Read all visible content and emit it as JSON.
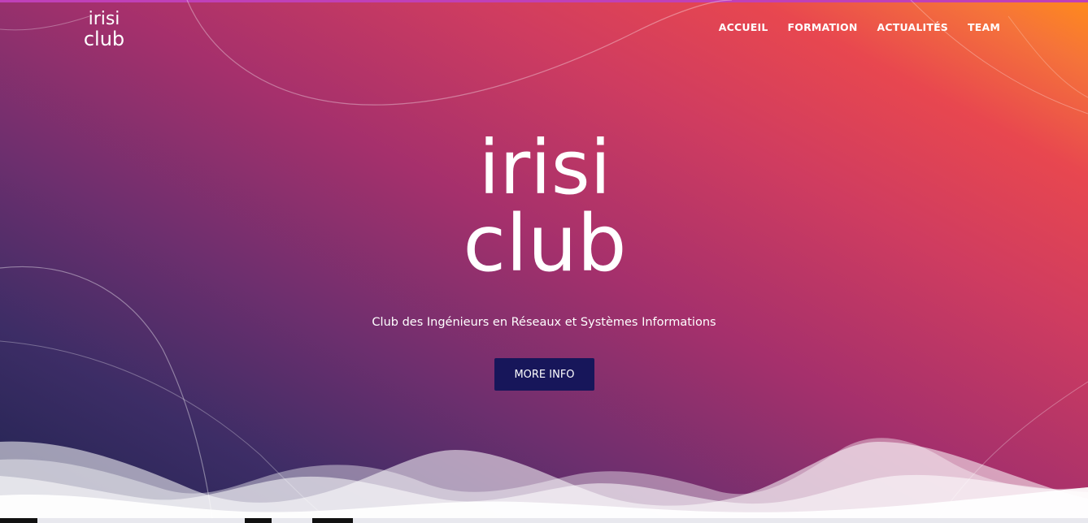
{
  "header": {
    "logo_text_top": "irisi",
    "logo_text_bottom": "club"
  },
  "nav": {
    "items": [
      {
        "label": "ACCUEIL"
      },
      {
        "label": "FORMATION"
      },
      {
        "label": "ACTUALITÉS"
      },
      {
        "label": "TEAM"
      }
    ]
  },
  "hero": {
    "logo_text_top": "irisi",
    "logo_text_bottom": "club",
    "tagline": "Club des Ingénieurs en Réseaux et Systèmes Informations",
    "cta_label": "MORE INFO"
  },
  "colors": {
    "gradient_start": "#1f2350",
    "gradient_mid": "#a5306c",
    "gradient_end": "#ff8a1c",
    "button_bg": "#17165a",
    "text": "#ffffff"
  }
}
